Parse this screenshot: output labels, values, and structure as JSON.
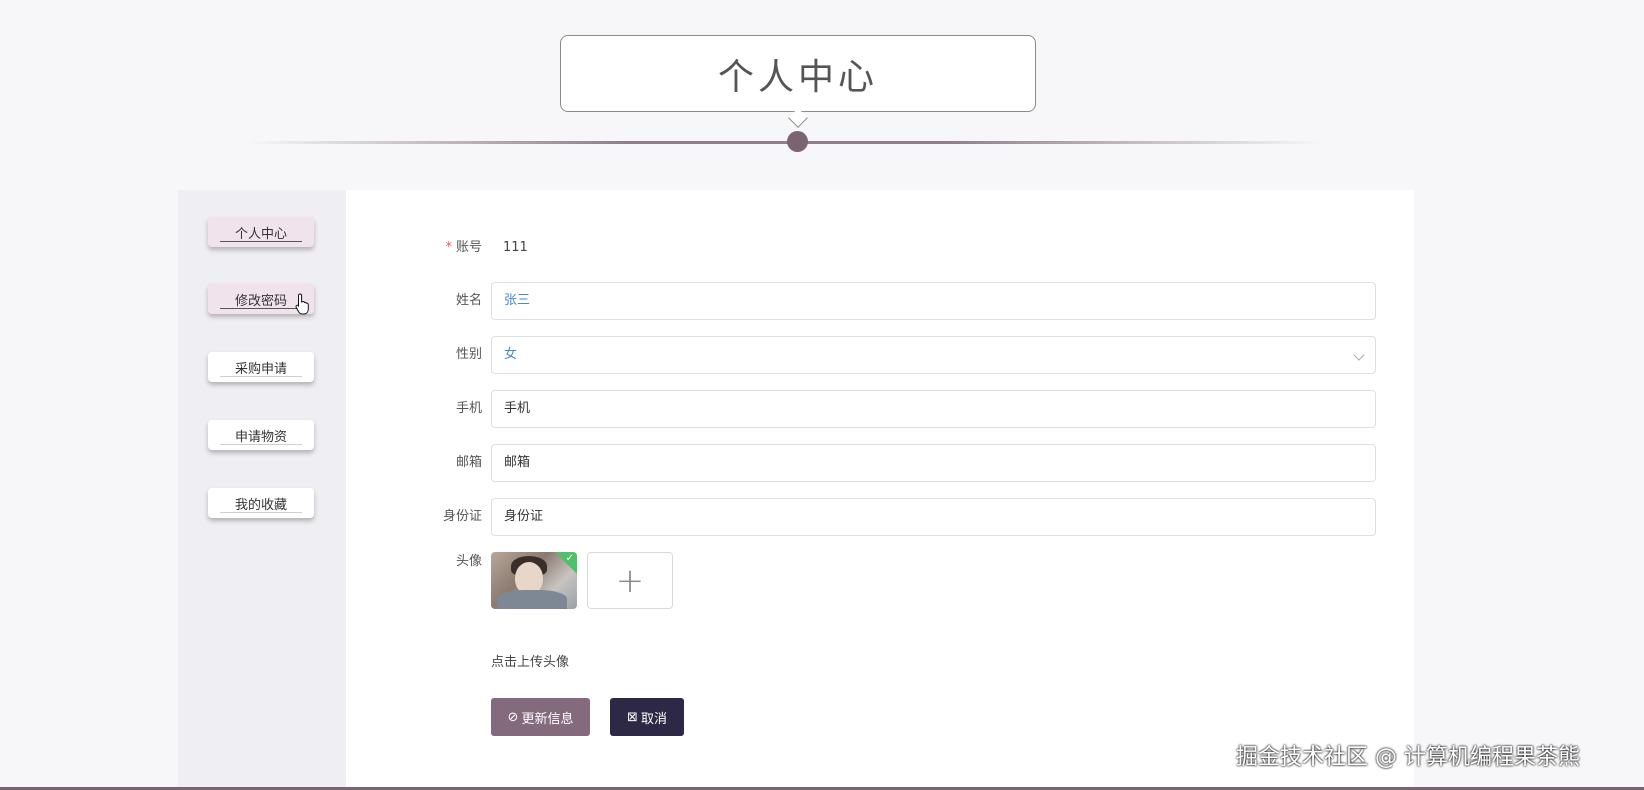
{
  "page": {
    "title": "个人中心"
  },
  "sidebar": {
    "items": [
      {
        "label": "个人中心",
        "active": true
      },
      {
        "label": "修改密码",
        "active": true
      },
      {
        "label": "采购申请",
        "active": false
      },
      {
        "label": "申请物资",
        "active": false
      },
      {
        "label": "我的收藏",
        "active": false
      }
    ]
  },
  "form": {
    "account": {
      "label": "账号",
      "required_mark": "*",
      "value": "111"
    },
    "name": {
      "label": "姓名",
      "value": "张三"
    },
    "gender": {
      "label": "性别",
      "value": "女"
    },
    "phone": {
      "label": "手机",
      "placeholder": "手机"
    },
    "email": {
      "label": "邮箱",
      "placeholder": "邮箱"
    },
    "id_card": {
      "label": "身份证",
      "placeholder": "身份证"
    },
    "avatar": {
      "label": "头像",
      "hint": "点击上传头像",
      "upload_symbol": "+"
    }
  },
  "actions": {
    "update_label": "更新信息",
    "cancel_label": "取消"
  },
  "watermark": "掘金技术社区 @ 计算机编程果茶熊",
  "colors": {
    "accent": "#836a7c",
    "dark_button": "#2c2845",
    "required": "#e35b5b",
    "success": "#4fbf6a"
  }
}
